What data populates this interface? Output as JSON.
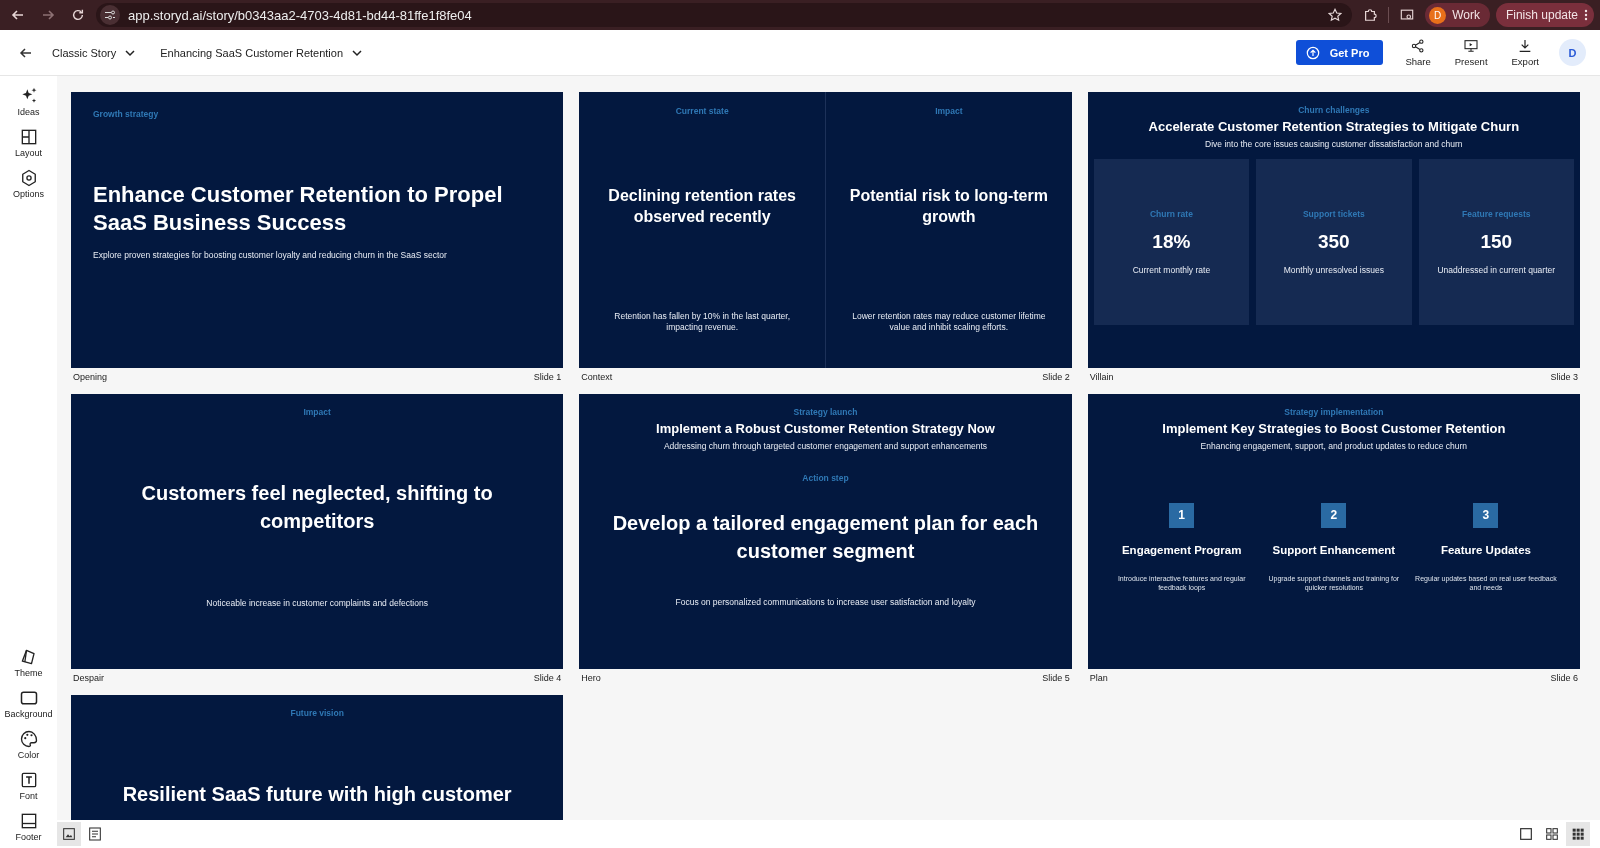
{
  "browser": {
    "url": "app.storyd.ai/story/b0343aa2-4703-4d81-bd44-81ffe1f8fe04",
    "profile": {
      "initial": "D",
      "label": "Work"
    },
    "update_button": "Finish update"
  },
  "header": {
    "template": "Classic Story",
    "story_title": "Enhancing SaaS Customer Retention",
    "cta": "Get Pro",
    "actions": [
      {
        "kind": "share",
        "label": "Share"
      },
      {
        "kind": "present",
        "label": "Present"
      },
      {
        "kind": "export",
        "label": "Export"
      }
    ],
    "avatar": "D"
  },
  "sidebar": {
    "top": [
      {
        "kind": "ideas",
        "label": "Ideas"
      },
      {
        "kind": "layout",
        "label": "Layout"
      },
      {
        "kind": "options",
        "label": "Options"
      }
    ],
    "bottom": [
      {
        "kind": "theme",
        "label": "Theme"
      },
      {
        "kind": "background",
        "label": "Background"
      },
      {
        "kind": "color",
        "label": "Color"
      },
      {
        "kind": "font",
        "label": "Font"
      },
      {
        "kind": "footer",
        "label": "Footer"
      }
    ]
  },
  "slides": [
    {
      "kind": "title",
      "eyebrow": "Growth strategy",
      "heading": "Enhance Customer Retention to Propel SaaS Business Success",
      "body": "Explore proven strategies for boosting customer loyalty and reducing churn in the SaaS sector",
      "label": "Opening",
      "number": "Slide 1"
    },
    {
      "kind": "two_column",
      "columns": [
        {
          "eyebrow": "Current state",
          "heading": "Declining retention rates observed recently",
          "body": "Retention has fallen by 10% in the last quarter, impacting revenue."
        },
        {
          "eyebrow": "Impact",
          "heading": "Potential risk to long-term growth",
          "body": "Lower retention rates may reduce customer lifetime value and inhibit scaling efforts."
        }
      ],
      "label": "Context",
      "number": "Slide 2"
    },
    {
      "kind": "stats",
      "eyebrow": "Churn challenges",
      "heading": "Accelerate Customer Retention Strategies to Mitigate Churn",
      "body": "Dive into the core issues causing customer dissatisfaction and churn",
      "stats": [
        {
          "label": "Churn rate",
          "value": "18%",
          "note": "Current monthly rate"
        },
        {
          "label": "Support tickets",
          "value": "350",
          "note": "Monthly unresolved issues"
        },
        {
          "label": "Feature requests",
          "value": "150",
          "note": "Unaddressed in current quarter"
        }
      ],
      "label": "Villain",
      "number": "Slide 3"
    },
    {
      "kind": "statement",
      "eyebrow": "Impact",
      "heading": "Customers feel neglected, shifting to competitors",
      "body": "Noticeable increase in customer complaints and defections",
      "label": "Despair",
      "number": "Slide 4"
    },
    {
      "kind": "hero",
      "intro": {
        "eyebrow": "Strategy launch",
        "heading": "Implement a Robust Customer Retention Strategy Now",
        "body": "Addressing churn through targeted customer engagement and support enhancements"
      },
      "main": {
        "eyebrow": "Action step",
        "heading": "Develop a tailored engagement plan for each customer segment",
        "body": "Focus on personalized communications to increase user satisfaction and loyalty"
      },
      "label": "Hero",
      "number": "Slide 5"
    },
    {
      "kind": "steps",
      "eyebrow": "Strategy implementation",
      "heading": "Implement Key Strategies to Boost Customer Retention",
      "body": "Enhancing engagement, support, and product updates to reduce churn",
      "steps": [
        {
          "number": "1",
          "title": "Engagement Program",
          "body": "Introduce interactive features and regular feedback loops"
        },
        {
          "number": "2",
          "title": "Support Enhancement",
          "body": "Upgrade support channels and training for quicker resolutions"
        },
        {
          "number": "3",
          "title": "Feature Updates",
          "body": "Regular updates based on real user feedback and needs"
        }
      ],
      "label": "Plan",
      "number": "Slide 6"
    },
    {
      "kind": "statement",
      "eyebrow": "Future vision",
      "heading": "Resilient SaaS future with high customer"
    }
  ],
  "view_toggles": {
    "left": [
      {
        "kind": "image",
        "selected": true
      },
      {
        "kind": "text",
        "selected": false
      }
    ],
    "right": [
      {
        "kind": "single",
        "selected": false
      },
      {
        "kind": "grid2",
        "selected": false
      },
      {
        "kind": "grid3",
        "selected": true
      }
    ]
  }
}
